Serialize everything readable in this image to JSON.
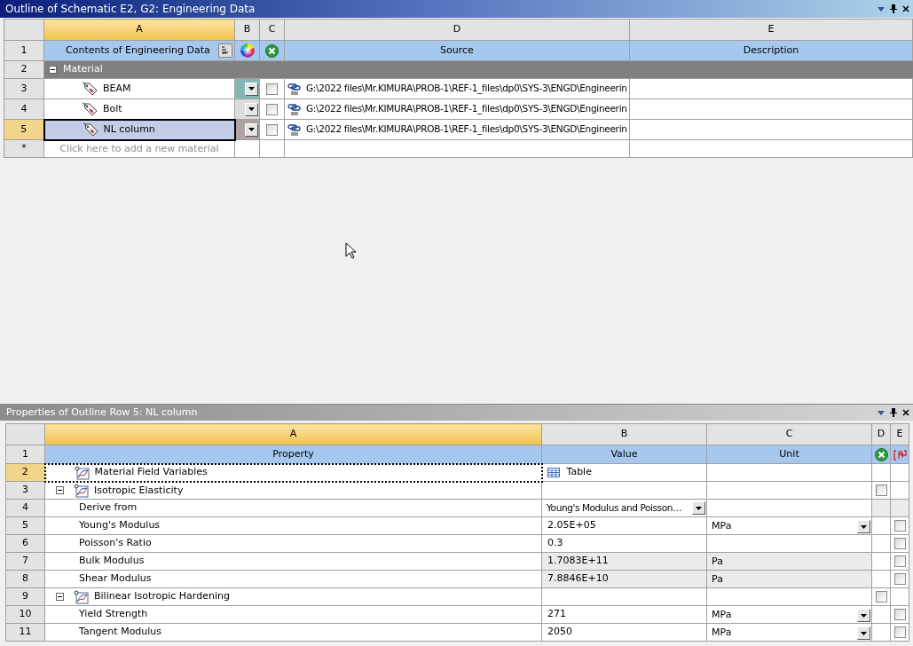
{
  "outline": {
    "title": "Outline of Schematic E2, G2: Engineering Data",
    "column_letters": [
      {
        "label": "A",
        "selected": true
      },
      {
        "label": "B",
        "selected": false
      },
      {
        "label": "C",
        "selected": false
      },
      {
        "label": "D",
        "selected": false
      },
      {
        "label": "E",
        "selected": false
      }
    ],
    "header": {
      "num": "1",
      "contents": "Contents of Engineering Data",
      "source": "Source",
      "description": "Description"
    },
    "category": {
      "num": "2",
      "label": "Material",
      "expanded": true
    },
    "materials": [
      {
        "num": "3",
        "name": "BEAM",
        "selected": false,
        "color": "#86b6b3",
        "checked": false,
        "source": "G:\\2022 files\\Mr.KIMURA\\PROB-1\\REF-1_files\\dp0\\SYS-3\\ENGD\\Engineerin"
      },
      {
        "num": "4",
        "name": "Bolt",
        "selected": false,
        "color": "#dcdcdc",
        "checked": false,
        "source": "G:\\2022 files\\Mr.KIMURA\\PROB-1\\REF-1_files\\dp0\\SYS-3\\ENGD\\Engineerin"
      },
      {
        "num": "5",
        "name": "NL column",
        "selected": true,
        "color": "#aea3a3",
        "checked": false,
        "source": "G:\\2022 files\\Mr.KIMURA\\PROB-1\\REF-1_files\\dp0\\SYS-3\\ENGD\\Engineerin"
      }
    ],
    "add_row": {
      "num": "*",
      "placeholder": "Click here to add a new material"
    }
  },
  "properties": {
    "title": "Properties of Outline Row 5: NL column",
    "column_letters": [
      {
        "label": "A",
        "selected": true
      },
      {
        "label": "B",
        "selected": false
      },
      {
        "label": "C",
        "selected": false
      },
      {
        "label": "D",
        "selected": false
      },
      {
        "label": "E",
        "selected": false
      }
    ],
    "header": {
      "num": "1",
      "property": "Property",
      "value": "Value",
      "unit": "Unit"
    },
    "rows": [
      {
        "num": "2",
        "kind": "table_link",
        "selected": true,
        "label": "Material Field Variables",
        "value": "Table"
      },
      {
        "num": "3",
        "kind": "group",
        "selected": false,
        "label": "Isotropic Elasticity",
        "expanded": true,
        "checked": false
      },
      {
        "num": "4",
        "kind": "option",
        "selected": false,
        "label": "Derive from",
        "value": "Young's Modulus and Poisson…"
      },
      {
        "num": "5",
        "kind": "quantity",
        "selected": false,
        "label": "Young's Modulus",
        "value": "2.05E+05",
        "unit": "MPa",
        "unit_dropdown": true,
        "readonly": false,
        "checked": false
      },
      {
        "num": "6",
        "kind": "quantity",
        "selected": false,
        "label": "Poisson's Ratio",
        "value": "0.3",
        "readonly": false,
        "checked": false
      },
      {
        "num": "7",
        "kind": "quantity",
        "selected": false,
        "label": "Bulk Modulus",
        "value": "1.7083E+11",
        "unit": "Pa",
        "unit_dropdown": false,
        "readonly": true,
        "checked": false
      },
      {
        "num": "8",
        "kind": "quantity",
        "selected": false,
        "label": "Shear Modulus",
        "value": "7.8846E+10",
        "unit": "Pa",
        "unit_dropdown": false,
        "readonly": true,
        "checked": false
      },
      {
        "num": "9",
        "kind": "group",
        "selected": false,
        "label": "Bilinear Isotropic Hardening",
        "expanded": true,
        "checked": false
      },
      {
        "num": "10",
        "kind": "quantity",
        "selected": false,
        "label": "Yield Strength",
        "value": "271",
        "unit": "MPa",
        "unit_dropdown": true,
        "readonly": false,
        "checked": false
      },
      {
        "num": "11",
        "kind": "quantity",
        "selected": false,
        "label": "Tangent Modulus",
        "value": "2050",
        "unit": "MPa",
        "unit_dropdown": true,
        "readonly": false,
        "checked": false
      }
    ]
  }
}
